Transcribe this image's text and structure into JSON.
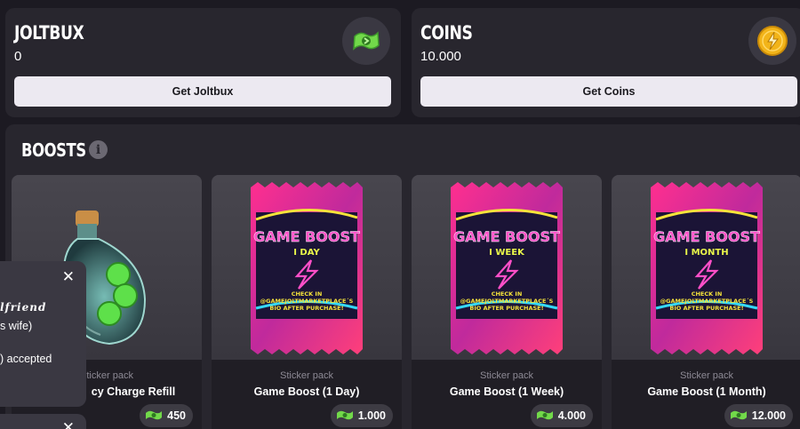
{
  "wallets": [
    {
      "title": "JOLTBUX",
      "value": "0",
      "button": "Get Joltbux",
      "icon": "joltbux-icon"
    },
    {
      "title": "COINS",
      "value": "10.000",
      "button": "Get Coins",
      "icon": "coin-icon"
    }
  ],
  "boosts": {
    "title": "BOOSTS",
    "info_icon": "i",
    "cards": [
      {
        "type": "Sticker pack",
        "name": "Emergency Charge Refill",
        "name_visible": "cy Charge Refill",
        "price": "450"
      },
      {
        "type": "Sticker pack",
        "name": "Game Boost (1 Day)",
        "price": "1.000",
        "pack_sub": "I DAY"
      },
      {
        "type": "Sticker pack",
        "name": "Game Boost (1 Week)",
        "price": "4.000",
        "pack_sub": "I WEEK"
      },
      {
        "type": "Sticker pack",
        "name": "Game Boost (1 Month)",
        "price": "12.000",
        "pack_sub": "I MONTH"
      }
    ],
    "pack": {
      "title": "GAME BOOST",
      "line1": "CHECK IN",
      "line2": "@GAMEJOLTMARKETPLACE´S",
      "line3": "BIO AFTER PURCHASE!"
    }
  },
  "toast": {
    "line1": "lfriend",
    "line2": "s wife)",
    "line3": ") accepted",
    "close": "✕"
  },
  "colors": {
    "background": "#1c1a22",
    "panel": "#28262e",
    "button": "#ece9f1",
    "accent_green": "#6fdc4e",
    "coin_gold": "#f2b419"
  }
}
